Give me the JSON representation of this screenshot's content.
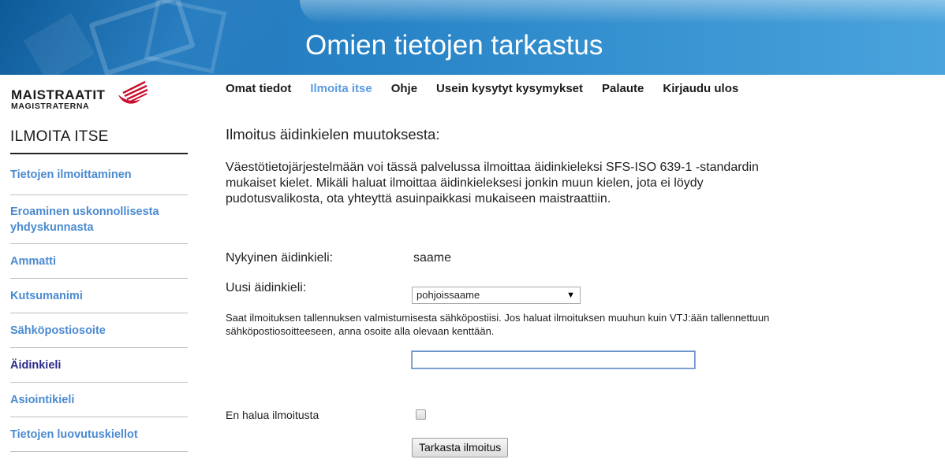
{
  "header": {
    "title": "Omien tietojen tarkastus"
  },
  "logo": {
    "main": "MAISTRAATIT",
    "sub": "MAGISTRATERNA",
    "brand_color": "#c8102e"
  },
  "sidebar": {
    "heading": "ILMOITA ITSE",
    "items": [
      {
        "label": "Tietojen ilmoittaminen",
        "active": false
      },
      {
        "label": "Eroaminen uskonnollisesta yhdyskunnasta",
        "active": false
      },
      {
        "label": "Ammatti",
        "active": false
      },
      {
        "label": "Kutsumanimi",
        "active": false
      },
      {
        "label": "Sähköpostiosoite",
        "active": false
      },
      {
        "label": "Äidinkieli",
        "active": true
      },
      {
        "label": "Asiointikieli",
        "active": false
      },
      {
        "label": "Tietojen luovutuskiellot",
        "active": false
      }
    ]
  },
  "top_nav": {
    "items": [
      {
        "label": "Omat tiedot",
        "active": false
      },
      {
        "label": "Ilmoita itse",
        "active": true
      },
      {
        "label": "Ohje",
        "active": false
      },
      {
        "label": "Usein kysytyt kysymykset",
        "active": false
      },
      {
        "label": "Palaute",
        "active": false
      },
      {
        "label": "Kirjaudu ulos",
        "active": false
      }
    ]
  },
  "main": {
    "title": "Ilmoitus äidinkielen muutoksesta:",
    "intro": "Väestötietojärjestelmään voi tässä palvelussa ilmoittaa äidinkieleksi SFS-ISO 639-1 -standardin mukaiset kielet. Mikäli haluat ilmoittaa äidinkieleksesi jonkin muun kielen, jota ei löydy pudotusvalikosta, ota yhteyttä asuinpaikkasi mukaiseen maistraattiin.",
    "current_label": "Nykyinen äidinkieli:",
    "current_value": "saame",
    "new_label": "Uusi äidinkieli:",
    "new_value": "pohjoissaame",
    "notice": "Saat ilmoituksen tallennuksen valmistumisesta sähköpostiisi. Jos haluat ilmoituksen muuhun kuin VTJ:ään tallennettuun sähköpostiosoitteeseen, anna osoite alla olevaan kenttään.",
    "email_value": "",
    "optout_label": "En halua ilmoitusta",
    "optout_checked": false,
    "submit_label": "Tarkasta ilmoitus"
  },
  "colors": {
    "banner": "#2a86c8",
    "link": "#4a8ad0",
    "active_side": "#2a2a8c",
    "active_top": "#5a9be0"
  }
}
